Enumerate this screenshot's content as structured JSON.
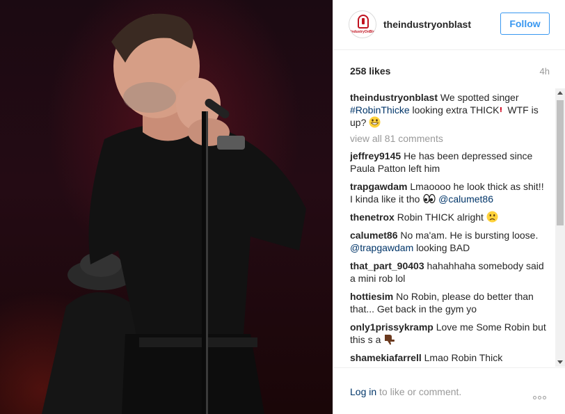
{
  "post": {
    "username": "theindustryonblast",
    "avatar_text": "IndustryOnBlast",
    "follow_label": "Follow",
    "likes": "258 likes",
    "time": "4h"
  },
  "caption": {
    "user": "theindustryonblast",
    "text_1": "We spotted singer",
    "hashtag": "#RobinThicke",
    "text_2": "looking extra THICK",
    "text_3": "WTF is up?"
  },
  "view_all": "view all 81 comments",
  "comments": [
    {
      "user": "jeffrey9145",
      "text": "He has been depressed since Paula Patton left him"
    },
    {
      "user": "trapgawdam",
      "text": "Lmaoooo he look thick as shit!! I kinda like it tho",
      "mention": "@calumet86"
    },
    {
      "user": "thenetrox",
      "text": "Robin THICK alright"
    },
    {
      "user": "calumet86",
      "text": "No ma'am. He is bursting loose.",
      "mention": "@trapgawdam",
      "text_after": "looking BAD"
    },
    {
      "user": "that_part_90403",
      "text": "hahahhaha somebody said a mini rob lol"
    },
    {
      "user": "hottiesim",
      "text": "No Robin, please do better than that... Get back in the gym yo"
    },
    {
      "user": "only1prissykramp",
      "text": "Love me Some Robin but this s a"
    },
    {
      "user": "shamekiafarrell",
      "text": "Lmao Robin Thick"
    }
  ],
  "footer": {
    "login_link": "Log in",
    "login_text": "to like or comment."
  },
  "colors": {
    "link": "#003569",
    "follow": "#3897f0",
    "muted": "#999999"
  },
  "icons": [
    "exclamation-icon",
    "grinning-emoji-icon",
    "eyes-emoji-icon",
    "frowning-emoji-icon",
    "thumbs-down-emoji-icon",
    "more-options-icon"
  ]
}
